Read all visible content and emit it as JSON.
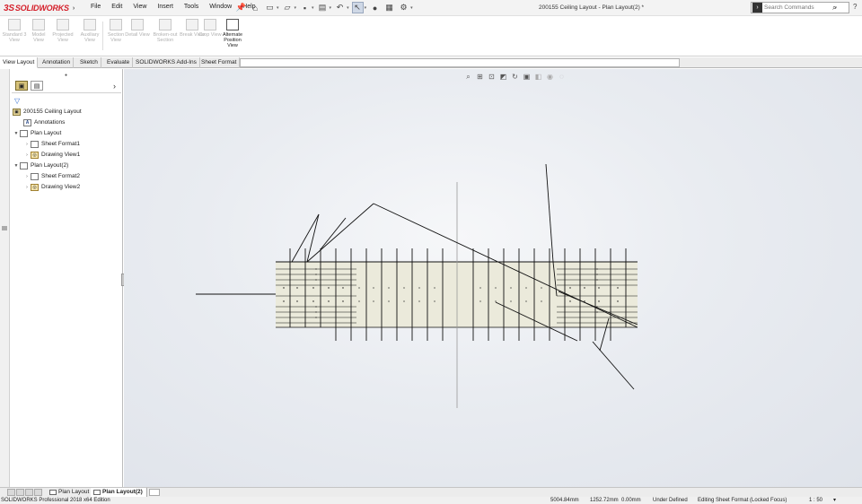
{
  "app": {
    "logo_text": "SOLIDWORKS",
    "logo_mark": "3S",
    "document_title": "200155 Ceiling Layout - Plan Layout(2) *"
  },
  "menu": [
    "File",
    "Edit",
    "View",
    "Insert",
    "Tools",
    "Window",
    "Help"
  ],
  "quick_access": [
    "pin-icon",
    "home-icon",
    "new-icon",
    "open-icon",
    "save-icon",
    "print-icon",
    "undo-icon",
    "select-icon",
    "rebuild-icon",
    "file-properties-icon",
    "options-icon"
  ],
  "search": {
    "placeholder": "Search Commands"
  },
  "ribbon": {
    "buttons": [
      {
        "label": "Standard 3 View",
        "enabled": false
      },
      {
        "label": "Model View",
        "enabled": false
      },
      {
        "label": "Projected View",
        "enabled": false
      },
      {
        "label": "Auxiliary View",
        "enabled": false
      },
      {
        "label": "Section View",
        "enabled": false
      },
      {
        "label": "Detail View",
        "enabled": false
      },
      {
        "label": "Broken-out Section",
        "enabled": false
      },
      {
        "label": "Break View",
        "enabled": false
      },
      {
        "label": "Crop View",
        "enabled": false
      },
      {
        "label": "Alternate Position View",
        "enabled": true
      }
    ]
  },
  "command_tabs": [
    "View Layout",
    "Annotation",
    "Sketch",
    "Evaluate",
    "SOLIDWORKS Add-Ins",
    "Sheet Format"
  ],
  "active_command_tab": "View Layout",
  "feature_tree": {
    "root": "200155 Ceiling Layout",
    "items": [
      {
        "label": "Annotations",
        "indent": 1,
        "expander": ""
      },
      {
        "label": "Plan Layout",
        "indent": 0,
        "expander": "▼"
      },
      {
        "label": "Sheet Format1",
        "indent": 2,
        "expander": "›"
      },
      {
        "label": "Drawing View1",
        "indent": 2,
        "expander": "›"
      },
      {
        "label": "Plan Layout(2)",
        "indent": 0,
        "expander": "▼"
      },
      {
        "label": "Sheet Format2",
        "indent": 2,
        "expander": "›"
      },
      {
        "label": "Drawing View2",
        "indent": 2,
        "expander": "›"
      }
    ]
  },
  "view_toolbar": [
    "zoom-to-fit-icon",
    "zoom-to-area-icon",
    "previous-view-icon",
    "section-view-icon",
    "rotate-icon",
    "display-style-icon",
    "hide-show-icon",
    "appearance-icon",
    "scene-icon"
  ],
  "sheet_tabs": [
    {
      "label": "Plan Layout",
      "active": false
    },
    {
      "label": "Plan Layout(2)",
      "active": true
    }
  ],
  "status": {
    "edition": "SOLIDWORKS Professional 2018 x64 Edition",
    "x": "5004.84mm",
    "y": "1252.72mm",
    "z": "0.00mm",
    "state": "Under Defined",
    "mode": "Editing Sheet Format (Locked Focus)",
    "scale": "1 : 50"
  },
  "colors": {
    "brand": "#d5202b",
    "canvas": "#e6e9ee",
    "slab_fill": "#ebeadb",
    "line": "#111111"
  }
}
